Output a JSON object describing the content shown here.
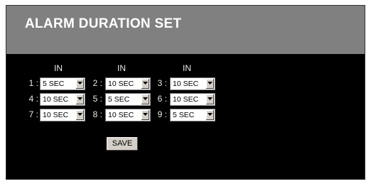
{
  "page": {
    "title": "ALARM DURATION SET"
  },
  "columns": {
    "headers": [
      "IN",
      "IN",
      "IN"
    ]
  },
  "alarms": [
    {
      "label": "1 :",
      "value": "5 SEC"
    },
    {
      "label": "2 :",
      "value": "10 SEC"
    },
    {
      "label": "3 :",
      "value": "10 SEC"
    },
    {
      "label": "4 :",
      "value": "10 SEC"
    },
    {
      "label": "5 :",
      "value": "5 SEC"
    },
    {
      "label": "6 :",
      "value": "10 SEC"
    },
    {
      "label": "7 :",
      "value": "10 SEC"
    },
    {
      "label": "8 :",
      "value": "10 SEC"
    },
    {
      "label": "9 :",
      "value": "5 SEC"
    }
  ],
  "actions": {
    "save_label": "SAVE"
  },
  "colors": {
    "background": "#000000",
    "header": "#808080",
    "title": "#ffffff",
    "button": "#d4d0c8"
  },
  "icons": {
    "dropdown": "chevron-down-icon"
  }
}
